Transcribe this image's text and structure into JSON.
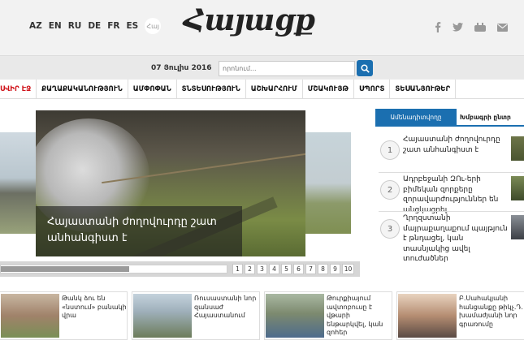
{
  "header": {
    "languages": [
      "AZ",
      "EN",
      "RU",
      "DE",
      "FR",
      "ES",
      "Հայ"
    ],
    "logo": "Հայացք",
    "social": [
      "facebook-icon",
      "twitter-icon",
      "youtube-icon",
      "mail-icon"
    ]
  },
  "search": {
    "date": "07 Յուլիս 2016",
    "placeholder": "որոնում..."
  },
  "nav": {
    "items": [
      "ՍՎԻՐ ԷՋ",
      "ՔԱՂԱՔԱԿԱՆՈՒԹՅՈՒՆ",
      "ԱՄՓՈՓԱՆ",
      "ՏՆՏԵՍՈՒԹՅՈՒՆ",
      "ԱՇԽԱՐՀՈՒՄ",
      "ՄՇԱԿՈՒՅԹ",
      "ՍՊՈՐՏ",
      "ՏԵՍԱՆՅՈՒԹԵՐ"
    ]
  },
  "slider": {
    "caption": "Հայաստանի ժողովուրդը շատ անհանգիստ է",
    "pages": [
      "1",
      "2",
      "3",
      "4",
      "5",
      "6",
      "7",
      "8",
      "9",
      "10"
    ],
    "scroll_position": 0.57
  },
  "sidebar": {
    "tabs": [
      "Ամենադիտվողը",
      "Խմբագրի ընտր"
    ],
    "items": [
      {
        "num": "1",
        "text": "Հայաստանի ժողովուրդը շատ անհանգիստ է"
      },
      {
        "num": "2",
        "text": "Ադրբեջանի ԶՈւ-երի բիմեկան զորքերը զորավարժություններ են անցկացրել"
      },
      {
        "num": "3",
        "text": "Ղրղզստանի մայրաքաղաքում պայթյուն է թնդացել, կան տասնյակից ավել տուժածներ"
      }
    ]
  },
  "cards": [
    {
      "text": "Թանկ ձու են «նստում» բանակի վրա"
    },
    {
      "text": "Ռուսաստանի նոր զանսաժ Հայաստանում"
    },
    {
      "text": "Թուրքիայում ավտոբուսը է վթարի ենթարկվել, կան զոհեր"
    },
    {
      "text": "Բ.Սահակյանի հանցանքը թիկչ.Դ. խամաժյանի նոր գրառումը"
    }
  ]
}
